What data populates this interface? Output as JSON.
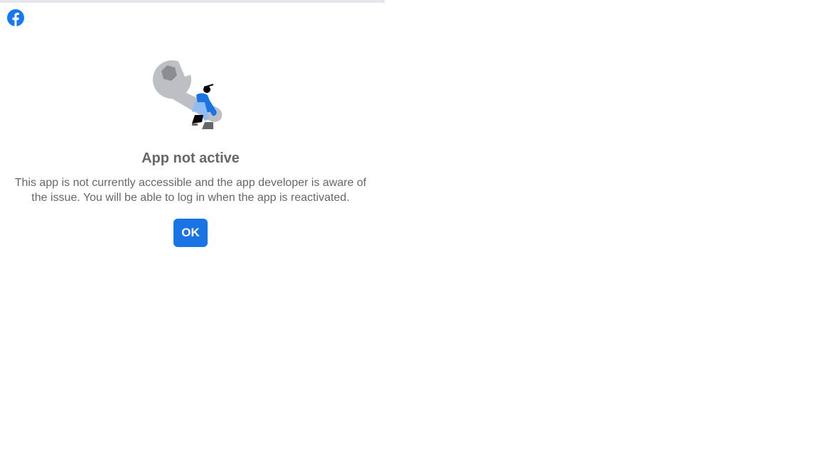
{
  "header": {
    "logo_icon": "facebook-logo-icon",
    "brand_color": "#1877f2"
  },
  "dialog": {
    "illustration_icon": "wrench-mechanic-illustration",
    "title": "App not active",
    "message": "This app is not currently accessible and the app developer is aware of the issue. You will be able to log in when the app is reactivated.",
    "ok_label": "OK",
    "button_color": "#1b74e4",
    "text_color": "#65676b"
  }
}
